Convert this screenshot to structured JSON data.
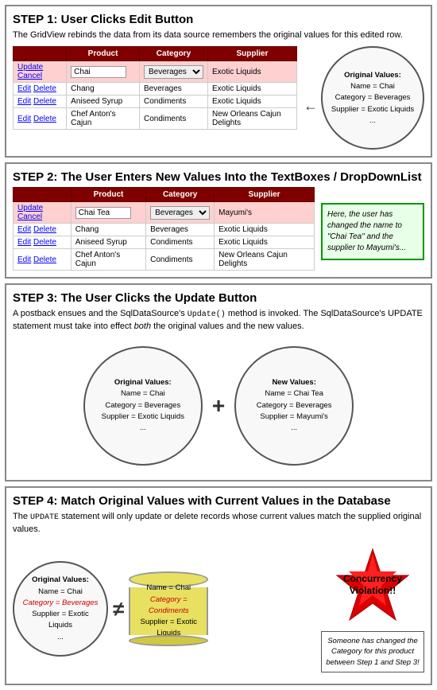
{
  "step1": {
    "title": "STEP 1: User Clicks Edit Button",
    "description": "The GridView rebinds the data from its data source remembers the original values for this edited row.",
    "table": {
      "headers": [
        "Product",
        "Category",
        "Supplier"
      ],
      "edit_row": {
        "actions": "Update Cancel",
        "product_value": "Chai",
        "category_value": "Beverages",
        "supplier_value": "Exotic Liquids"
      },
      "rows": [
        {
          "actions": "Edit Delete",
          "product": "Chang",
          "category": "Beverages",
          "supplier": "Exotic Liquids"
        },
        {
          "actions": "Edit Delete",
          "product": "Aniseed Syrup",
          "category": "Condiments",
          "supplier": "Exotic Liquids"
        },
        {
          "actions": "Edit Delete",
          "product": "Chef Anton's Cajun",
          "category": "Condiments",
          "supplier": "New Orleans Cajun Delights"
        }
      ]
    },
    "bubble": {
      "title": "Original Values:",
      "line1": "Name = Chai",
      "line2": "Category = Beverages",
      "line3": "Supplier = Exotic Liquids",
      "ellipsis": "..."
    }
  },
  "step2": {
    "title": "STEP 2: The User Enters New Values Into the TextBoxes / DropDownList",
    "table": {
      "headers": [
        "Product",
        "Category",
        "Supplier"
      ],
      "edit_row": {
        "actions": "Update Cancel",
        "product_value": "Chai Tea",
        "category_value": "Beverages",
        "supplier_value": "Mayumi's"
      },
      "rows": [
        {
          "actions": "Edit Delete",
          "product": "Chang",
          "category": "Beverages",
          "supplier": "Exotic Liquids"
        },
        {
          "actions": "Edit Delete",
          "product": "Aniseed Syrup",
          "category": "Condiments",
          "supplier": "Exotic Liquids"
        },
        {
          "actions": "Edit Delete",
          "product": "Chef Anton's Cajun",
          "category": "Condiments",
          "supplier": "New Orleans Cajun Delights"
        }
      ]
    },
    "note": "Here, the user has changed the name to \"Chai Tea\" and the supplier to Mayumi's..."
  },
  "step3": {
    "title": "STEP 3: The User Clicks the Update Button",
    "description": "A postback ensues and the SqlDataSource's Update() method is invoked. The SqlDataSource's UPDATE statement must take into effect both the original values and the new values.",
    "original": {
      "title": "Original Values:",
      "line1": "Name = Chai",
      "line2": "Category = Beverages",
      "line3": "Supplier = Exotic Liquids",
      "ellipsis": "..."
    },
    "new_vals": {
      "title": "New Values:",
      "line1": "Name = Chai Tea",
      "line2": "Category = Beverages",
      "line3": "Supplier = Mayumi's",
      "ellipsis": "..."
    },
    "plus": "+"
  },
  "step4": {
    "title": "STEP 4: Match Original Values with Current Values in the Database",
    "description": "The UPDATE statement will only update or delete records whose current values match the supplied original values.",
    "original_bubble": {
      "title": "Original Values:",
      "line1": "Name = Chai",
      "line2_label": "Category = Beverages",
      "line3": "Supplier = Exotic Liquids",
      "ellipsis": "..."
    },
    "db_cylinder": {
      "line1": "Name = Chai",
      "line2_label": "Category = Condiments",
      "line3": "Supplier = Exotic Liquids"
    },
    "concurrency_label": "Concurrency Violation!!",
    "italic_note": "Someone has changed the Category for this product between Step 1 and Step 3!"
  }
}
